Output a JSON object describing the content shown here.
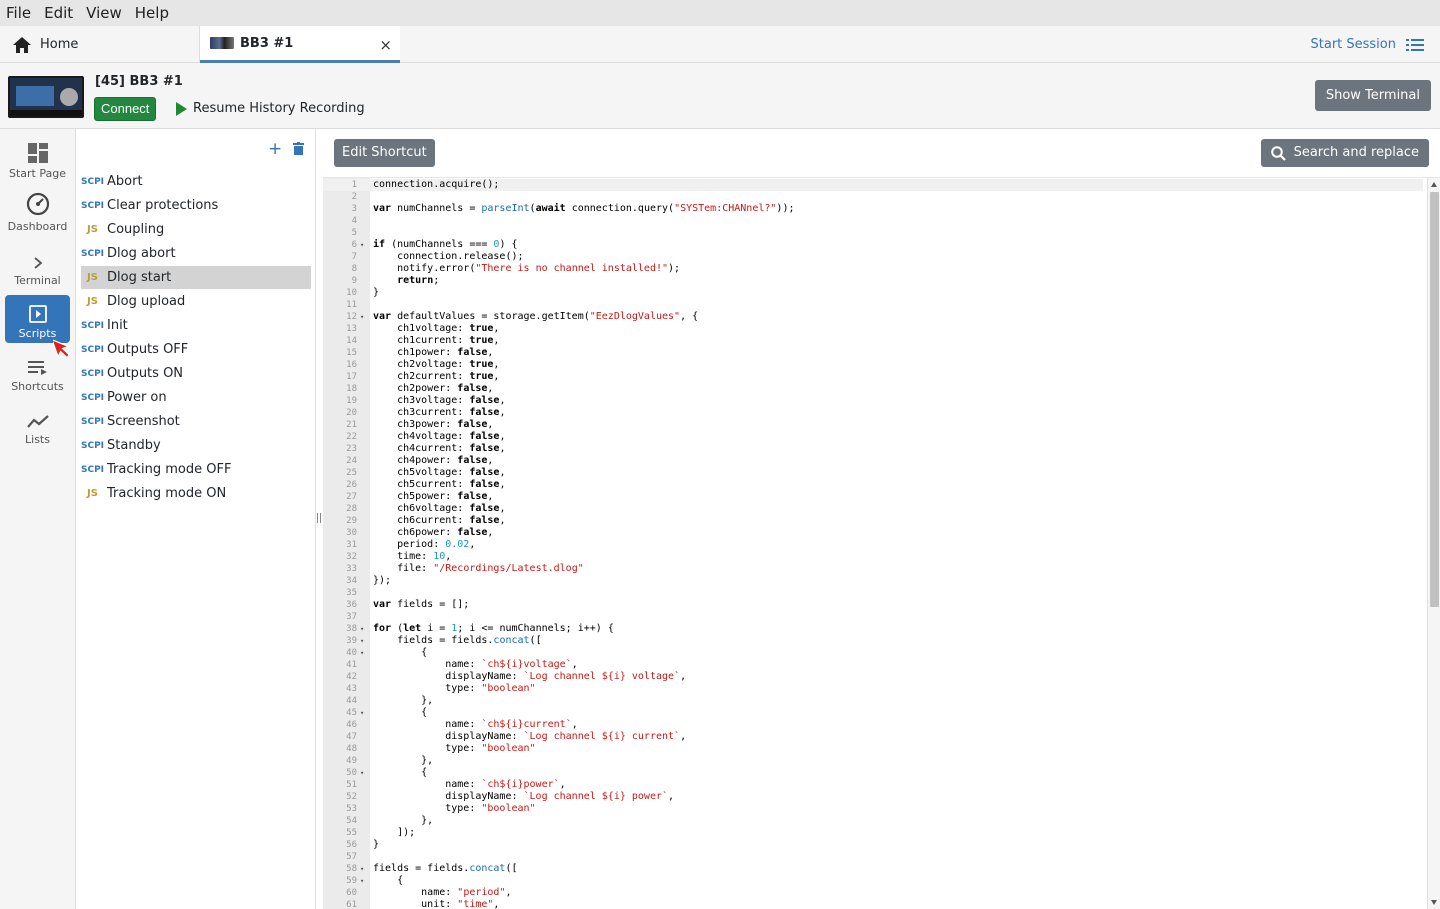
{
  "menu": [
    "File",
    "Edit",
    "View",
    "Help"
  ],
  "tabs": {
    "home_label": "Home",
    "active_label": "BB3 #1",
    "close_symbol": "×",
    "start_session": "Start Session"
  },
  "instrument": {
    "title": "[45] BB3 #1",
    "connect_label": "Connect",
    "resume_label": "Resume History Recording",
    "show_terminal": "Show Terminal"
  },
  "nav": [
    {
      "label": "Start Page",
      "icon": "grid-icon"
    },
    {
      "label": "Dashboard",
      "icon": "gauge-icon"
    },
    {
      "label": "Terminal",
      "icon": "chevron-right-icon"
    },
    {
      "label": "Scripts",
      "icon": "play-box-icon",
      "active": true
    },
    {
      "label": "Shortcuts",
      "icon": "list-arrow-icon"
    },
    {
      "label": "Lists",
      "icon": "trend-line-icon"
    }
  ],
  "scripts": [
    {
      "type": "SCPI",
      "name": "Abort"
    },
    {
      "type": "SCPI",
      "name": "Clear protections"
    },
    {
      "type": "JS",
      "name": "Coupling"
    },
    {
      "type": "SCPI",
      "name": "Dlog abort"
    },
    {
      "type": "JS",
      "name": "Dlog start",
      "selected": true
    },
    {
      "type": "JS",
      "name": "Dlog upload"
    },
    {
      "type": "SCPI",
      "name": "Init"
    },
    {
      "type": "SCPI",
      "name": "Outputs OFF"
    },
    {
      "type": "SCPI",
      "name": "Outputs ON"
    },
    {
      "type": "SCPI",
      "name": "Power on"
    },
    {
      "type": "SCPI",
      "name": "Screenshot"
    },
    {
      "type": "SCPI",
      "name": "Standby"
    },
    {
      "type": "SCPI",
      "name": "Tracking mode OFF"
    },
    {
      "type": "JS",
      "name": "Tracking mode ON"
    }
  ],
  "editor": {
    "edit_shortcut": "Edit Shortcut",
    "search_replace": "Search and replace"
  },
  "code_lines": [
    "connection.acquire();",
    "",
    "var numChannels = parseInt(await connection.query(\"SYSTem:CHANnel?\"));",
    "",
    "",
    "if (numChannels === 0) {",
    "    connection.release();",
    "    notify.error(\"There is no channel installed!\");",
    "    return;",
    "}",
    "",
    "var defaultValues = storage.getItem(\"EezDlogValues\", {",
    "    ch1voltage: true,",
    "    ch1current: true,",
    "    ch1power: false,",
    "    ch2voltage: true,",
    "    ch2current: true,",
    "    ch2power: false,",
    "    ch3voltage: false,",
    "    ch3current: false,",
    "    ch3power: false,",
    "    ch4voltage: false,",
    "    ch4current: false,",
    "    ch4power: false,",
    "    ch5voltage: false,",
    "    ch5current: false,",
    "    ch5power: false,",
    "    ch6voltage: false,",
    "    ch6current: false,",
    "    ch6power: false,",
    "    period: 0.02,",
    "    time: 10,",
    "    file: \"/Recordings/Latest.dlog\"",
    "});",
    "",
    "var fields = [];",
    "",
    "for (let i = 1; i <= numChannels; i++) {",
    "    fields = fields.concat([",
    "        {",
    "            name: `ch${i}voltage`,",
    "            displayName: `Log channel ${i} voltage`,",
    "            type: \"boolean\"",
    "        },",
    "        {",
    "            name: `ch${i}current`,",
    "            displayName: `Log channel ${i} current`,",
    "            type: \"boolean\"",
    "        },",
    "        {",
    "            name: `ch${i}power`,",
    "            displayName: `Log channel ${i} power`,",
    "            type: \"boolean\"",
    "        },",
    "    ]);",
    "}",
    "",
    "fields = fields.concat([",
    "    {",
    "        name: \"period\",",
    "        unit: \"time\","
  ],
  "fold_lines": [
    6,
    12,
    38,
    39,
    40,
    45,
    50,
    58,
    59
  ]
}
